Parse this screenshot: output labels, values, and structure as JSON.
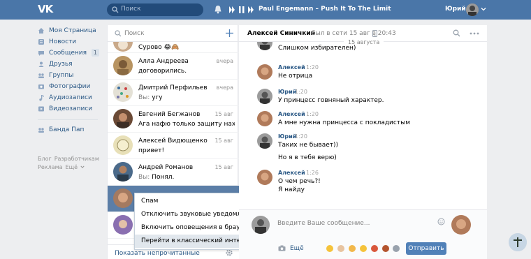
{
  "header": {
    "logo": "VK",
    "search_placeholder": "Поиск",
    "track": "Paul Engemann – Push It To The Limit",
    "user_name": "Юрий"
  },
  "sidebar": {
    "items": [
      {
        "label": "Моя Страница",
        "icon": "home-icon"
      },
      {
        "label": "Новости",
        "icon": "news-icon"
      },
      {
        "label": "Сообщения",
        "icon": "messages-icon",
        "badge": "1"
      },
      {
        "label": "Друзья",
        "icon": "friends-icon"
      },
      {
        "label": "Группы",
        "icon": "groups-icon"
      },
      {
        "label": "Фотографии",
        "icon": "photos-icon"
      },
      {
        "label": "Аудиозаписи",
        "icon": "music-icon"
      },
      {
        "label": "Видеозаписи",
        "icon": "video-icon"
      }
    ],
    "extra": [
      {
        "label": "Банда Пап",
        "icon": "group-icon"
      }
    ],
    "footer": [
      "Блог",
      "Разработчикам",
      "Реклама",
      "Ещё"
    ]
  },
  "conversations": {
    "search_placeholder": "Поиск",
    "items": [
      {
        "name": "",
        "time": "",
        "text": "Сурово 😂🙈",
        "you": false
      },
      {
        "name": "Алла Андреева",
        "time": "вчера",
        "text": "договорились.",
        "you": false
      },
      {
        "name": "Дмитрий Перфильев",
        "time": "вчера",
        "you_label": "Вы:",
        "text": "угу",
        "you": true
      },
      {
        "name": "Евгений Бегжанов",
        "time": "15 авг",
        "text": "Ага нафю только защиту нахуй убр...",
        "you": false
      },
      {
        "name": "Алексей Видющенко",
        "time": "15 авг",
        "text": "привет!",
        "you": false
      },
      {
        "name": "Андрей Романов",
        "time": "15 авг",
        "you_label": "Вы:",
        "text": "Понял.",
        "you": true
      },
      {
        "name": "",
        "time": "",
        "text": "",
        "you": false
      },
      {
        "name": "",
        "time": "",
        "text": "",
        "you": false
      }
    ],
    "footer_label": "Показать непрочитанные"
  },
  "context_menu": {
    "items": [
      "Спам",
      "Отключить звуковые уведомления",
      "Включить оповещения в браузере",
      "Перейти в классический интерфейс"
    ]
  },
  "chat": {
    "name": "Алексей Синичкин",
    "status": "был в сети 15 авг в 20:43",
    "date_separator": "15 августа",
    "messages": [
      {
        "author": "",
        "time": "",
        "lines": [
          "Слишком избирателен)"
        ],
        "who": "me"
      },
      {
        "author": "Алексей",
        "time": "1:20",
        "lines": [
          "Не отрица"
        ],
        "who": "them"
      },
      {
        "author": "Юрий",
        "time": "1:20",
        "lines": [
          "У принцесс говняный характер."
        ],
        "who": "me"
      },
      {
        "author": "Алексей",
        "time": "1:20",
        "lines": [
          "А мне нужна принцесса с покладистым"
        ],
        "who": "them"
      },
      {
        "author": "Юрий",
        "time": "1:20",
        "lines": [
          "Таких не бывает))",
          "Но я в тебя верю)"
        ],
        "who": "me"
      },
      {
        "author": "Алексей",
        "time": "1:26",
        "lines": [
          "О чем речь?!",
          "Я найду"
        ],
        "who": "them"
      }
    ],
    "compose_placeholder": "Введите Ваше сообщение...",
    "more_label": "Ещё",
    "send_label": "Отправить"
  },
  "colors": {
    "header": "#4a76a8",
    "link": "#2a5885",
    "send_button": "#5181b8",
    "active_row": "#5b7ea7"
  }
}
